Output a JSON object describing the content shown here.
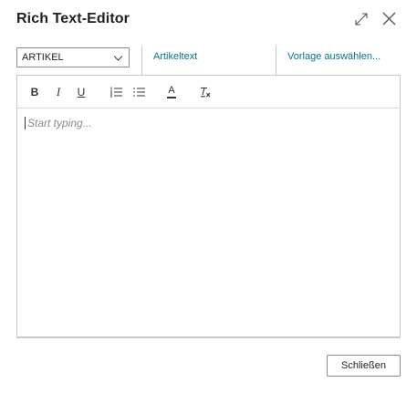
{
  "dialog": {
    "title": "Rich Text-Editor",
    "icons": {
      "expand": "expand-icon",
      "close": "close-icon"
    }
  },
  "controls": {
    "select_value": "ARTIKEL",
    "link_text": "Artikeltext",
    "template_link": "Vorlage auswählen..."
  },
  "toolbar": {
    "buttons": [
      {
        "name": "bold",
        "glyph": "B"
      },
      {
        "name": "italic",
        "glyph": "I"
      },
      {
        "name": "underline",
        "glyph": "U"
      },
      {
        "name": "numbered-list",
        "glyph": "numbered-list-icon"
      },
      {
        "name": "bulleted-list",
        "glyph": "bulleted-list-icon"
      },
      {
        "name": "font-color",
        "glyph": "A"
      },
      {
        "name": "clear-format",
        "glyph": "Tx"
      }
    ]
  },
  "editor": {
    "placeholder": "Start typing..."
  },
  "footer": {
    "close_label": "Schließen"
  },
  "colors": {
    "link": "#00788a",
    "border": "#c8c8c8",
    "text": "#212121",
    "placeholder": "#8a8a8a"
  }
}
